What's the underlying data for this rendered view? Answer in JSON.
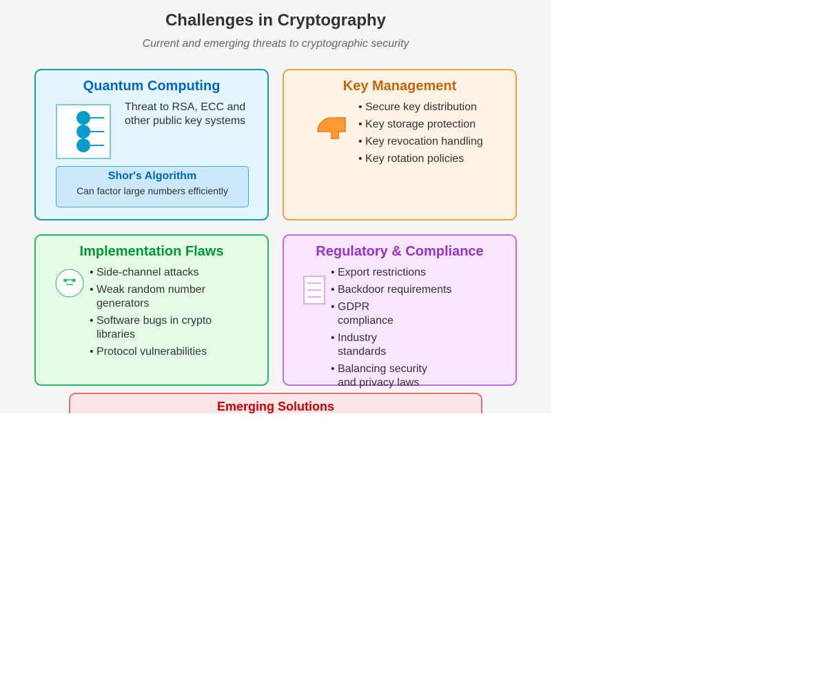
{
  "header": {
    "title": "Challenges in Cryptography",
    "subtitle": "Current and emerging threats to cryptographic security"
  },
  "quantum": {
    "title": "Quantum Computing",
    "description": "Threat to RSA, ECC and other public key systems",
    "shor_title": "Shor's Algorithm",
    "shor_text": "Can factor large numbers efficiently",
    "icon": "qubit-circuit-icon",
    "accent_color": "#0066cc",
    "border_color": "#0f9bbd",
    "background_color": "#e5f5fc"
  },
  "key_management": {
    "title": "Key Management",
    "items": [
      "Secure key distribution",
      "Key storage protection",
      "Key revocation handling",
      "Key rotation policies"
    ],
    "icon": "key-icon",
    "accent_color": "#cc6600",
    "border_color": "#f5a23d",
    "background_color": "#fef2e6"
  },
  "implementation": {
    "title": "Implementation Flaws",
    "items": [
      "Side-channel attacks",
      "Weak random number generators",
      "Software bugs in crypto libraries",
      "Protocol vulnerabilities"
    ],
    "icon": "bug-face-icon",
    "accent_color": "#009933",
    "border_color": "#22bb66",
    "background_color": "#e5fde6"
  },
  "regulatory": {
    "title": "Regulatory & Compliance",
    "items": [
      "Export restrictions",
      "Backdoor requirements",
      "GDPR compliance",
      "Industry standards",
      "Balancing security and privacy laws"
    ],
    "icon": "document-icon",
    "accent_color": "#9933cc",
    "border_color": "#c76ae6",
    "background_color": "#f7e6fd"
  },
  "emerging": {
    "title": "Emerging Solutions",
    "accent_color": "#cc0000",
    "border_color": "#e87070",
    "background_color": "#fde6e7"
  }
}
